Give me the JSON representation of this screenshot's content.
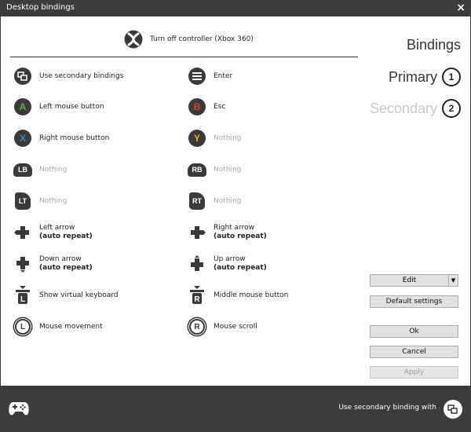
{
  "window": {
    "title": "Desktop bindings",
    "close_glyph": "×"
  },
  "controller": {
    "label": "Turn off controller (Xbox 360)",
    "icon": "xbox-logo-icon"
  },
  "side": {
    "bindings": "Bindings",
    "primary": "Primary",
    "primary_num": "1",
    "secondary": "Secondary",
    "secondary_num": "2"
  },
  "colors": {
    "a_button": "#66b32e",
    "b_button": "#e53d2b",
    "x_button": "#2d8ed6",
    "y_button": "#f0b21c",
    "dark": "#3c3c3c"
  },
  "bindings": {
    "secondary_bindings": "Use secondary bindings",
    "menu": "Enter",
    "a": "Left mouse button",
    "b": "Esc",
    "x": "Right mouse button",
    "y": "Nothing",
    "lb": "Nothing",
    "rb": "Nothing",
    "lt": "Nothing",
    "rt": "Nothing",
    "left_arrow": "Left arrow",
    "right_arrow": "Right arrow",
    "down_arrow": "Down arrow",
    "up_arrow": "Up arrow",
    "auto_repeat": "(auto repeat)",
    "l_click": "Show virtual keyboard",
    "r_click": "Middle mouse button",
    "l_stick": "Mouse movement",
    "r_stick": "Mouse scroll"
  },
  "button_glyphs": {
    "a": "A",
    "b": "B",
    "x": "X",
    "y": "Y",
    "lb": "LB",
    "rb": "RB",
    "lt": "LT",
    "rt": "RT",
    "l": "L",
    "r": "R"
  },
  "buttons": {
    "edit": "Edit",
    "default_settings": "Default settings",
    "ok": "Ok",
    "cancel": "Cancel",
    "apply": "Apply"
  },
  "footer": {
    "secondary_binding_with": "Use secondary binding with"
  }
}
